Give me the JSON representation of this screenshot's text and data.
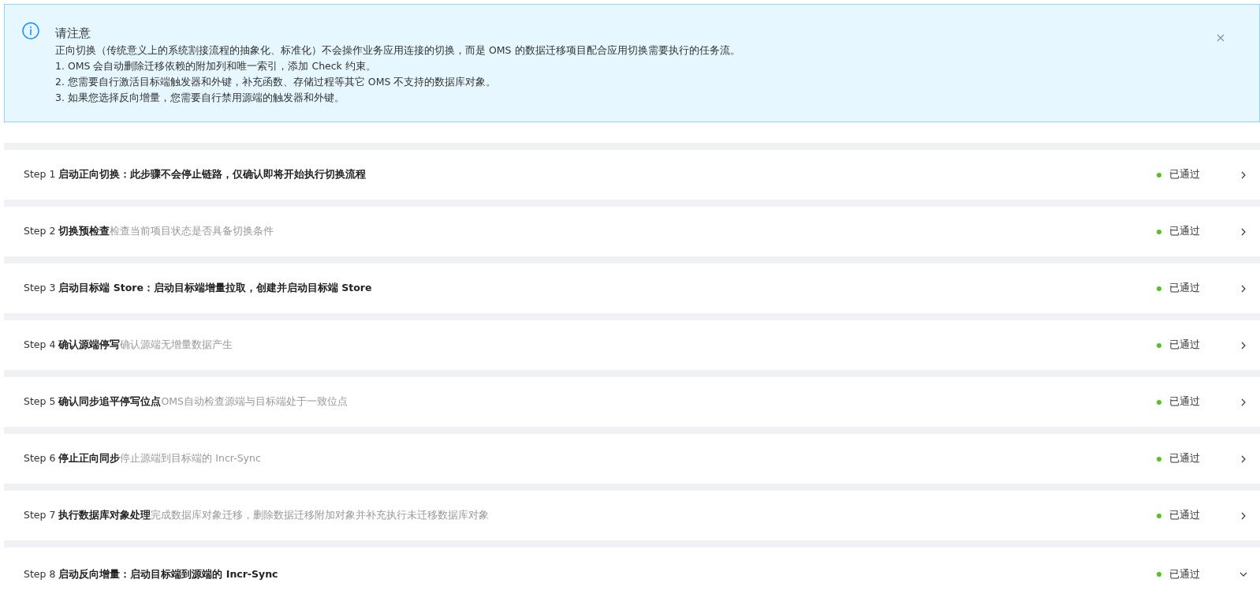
{
  "notice": {
    "title": "请注意",
    "lines": [
      "正向切换（传统意义上的系统割接流程的抽象化、标准化）不会操作业务应用连接的切换，而是 OMS 的数据迁移项目配合应用切换需要执行的任务流。",
      "1. OMS 会自动删除迁移依赖的附加列和唯一索引，添加 Check 约束。",
      "2. 您需要自行激活目标端触发器和外键，补充函数、存储过程等其它 OMS 不支持的数据库对象。",
      "3. 如果您选择反向增量，您需要自行禁用源端的触发器和外键。"
    ]
  },
  "steps": [
    {
      "step": "Step 1",
      "title": "启动正向切换：此步骤不会停止链路，仅确认即将开始执行切换流程",
      "status": "已通过",
      "color": "#52c41a",
      "expanded": false
    },
    {
      "step": "Step 2",
      "title": "切换预检查",
      "description": "检查当前项目状态是否具备切换条件",
      "status": "已通过",
      "color": "#52c41a",
      "expanded": false
    },
    {
      "step": "Step 3",
      "title": "启动目标端 Store：启动目标端增量拉取，创建并启动目标端 Store",
      "status": "已通过",
      "color": "#52c41a",
      "expanded": false
    },
    {
      "step": "Step 4",
      "title": "确认源端停写",
      "description": "确认源端无增量数据产生",
      "status": "已通过",
      "color": "#52c41a",
      "expanded": false
    },
    {
      "step": "Step 5",
      "title": "确认同步追平停写位点",
      "description": "OMS自动检查源端与目标端处于一致位点",
      "status": "已通过",
      "color": "#52c41a",
      "expanded": false
    },
    {
      "step": "Step 6",
      "title": "停止正向同步",
      "description": "停止源端到目标端的 Incr-Sync",
      "status": "已通过",
      "color": "#52c41a",
      "expanded": false
    },
    {
      "step": "Step 7",
      "title": "执行数据库对象处理",
      "description": "完成数据库对象迁移，删除数据迁移附加对象并补充执行未迁移数据库对象",
      "status": "已通过",
      "color": "#52c41a",
      "expanded": false
    },
    {
      "step": "Step 8",
      "title": "启动反向增量：启动目标端到源端的 Incr-Sync",
      "status": "已通过",
      "color": "#52c41a",
      "expanded": true
    }
  ]
}
